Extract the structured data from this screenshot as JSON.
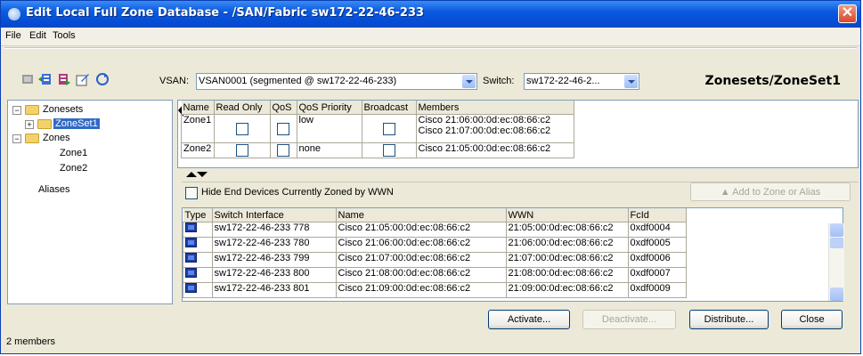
{
  "window": {
    "title": "Edit Local Full Zone Database - /SAN/Fabric sw172-22-46-233"
  },
  "menu": [
    "File",
    "Edit",
    "Tools"
  ],
  "toolbar": {
    "icons": [
      "delete-icon",
      "insert-zoneset-icon",
      "insert-zone-icon",
      "edit-icon",
      "refresh-icon"
    ],
    "vsan_label": "VSAN:",
    "vsan_value": "VSAN0001 (segmented @ sw172-22-46-233)",
    "switch_label": "Switch:",
    "switch_value": "sw172-22-46-2..."
  },
  "heading": "Zonesets/ZoneSet1",
  "tree": {
    "zonesets": "Zonesets",
    "zoneset1": "ZoneSet1",
    "zones": "Zones",
    "zone1": "Zone1",
    "zone2": "Zone2",
    "aliases": "Aliases"
  },
  "zones_table": {
    "headers": [
      "Name",
      "Read Only",
      "QoS",
      "QoS Priority",
      "Broadcast",
      "Members"
    ],
    "rows": [
      {
        "name": "Zone1",
        "qos_priority": "low",
        "members": [
          "Cisco 21:06:00:0d:ec:08:66:c2",
          "Cisco 21:07:00:0d:ec:08:66:c2"
        ]
      },
      {
        "name": "Zone2",
        "qos_priority": "none",
        "members": [
          "Cisco 21:05:00:0d:ec:08:66:c2"
        ]
      }
    ]
  },
  "hide_checkbox_label": "Hide End Devices Currently Zoned by WWN",
  "add_button": "Add to Zone or Alias",
  "devices_table": {
    "headers": [
      "Type",
      "Switch Interface",
      "Name",
      "WWN",
      "FcId"
    ],
    "rows": [
      {
        "interface": "sw172-22-46-233 778",
        "name": "Cisco 21:05:00:0d:ec:08:66:c2",
        "wwn": "21:05:00:0d:ec:08:66:c2",
        "fcid": "0xdf0004"
      },
      {
        "interface": "sw172-22-46-233 780",
        "name": "Cisco 21:06:00:0d:ec:08:66:c2",
        "wwn": "21:06:00:0d:ec:08:66:c2",
        "fcid": "0xdf0005"
      },
      {
        "interface": "sw172-22-46-233 799",
        "name": "Cisco 21:07:00:0d:ec:08:66:c2",
        "wwn": "21:07:00:0d:ec:08:66:c2",
        "fcid": "0xdf0006"
      },
      {
        "interface": "sw172-22-46-233 800",
        "name": "Cisco 21:08:00:0d:ec:08:66:c2",
        "wwn": "21:08:00:0d:ec:08:66:c2",
        "fcid": "0xdf0007"
      },
      {
        "interface": "sw172-22-46-233 801",
        "name": "Cisco 21:09:00:0d:ec:08:66:c2",
        "wwn": "21:09:00:0d:ec:08:66:c2",
        "fcid": "0xdf0009"
      }
    ]
  },
  "buttons": {
    "activate": "Activate...",
    "deactivate": "Deactivate...",
    "distribute": "Distribute...",
    "close": "Close"
  },
  "status": "2 members"
}
